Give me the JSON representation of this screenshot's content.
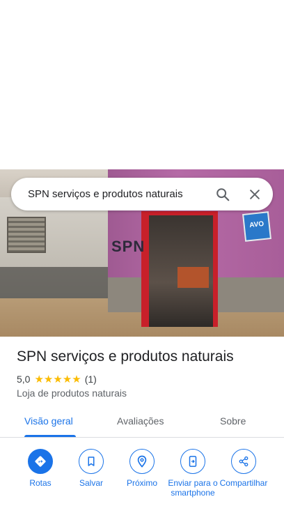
{
  "search": {
    "query": "SPN serviços e produtos naturais",
    "search_icon": "search-icon",
    "clear_icon": "close-icon"
  },
  "hero": {
    "sign_text": "SPN",
    "poster_text": "AVO"
  },
  "place": {
    "name": "SPN serviços e produtos naturais",
    "rating": "5,0",
    "stars": 5,
    "review_count": "(1)",
    "category": "Loja de produtos naturais"
  },
  "tabs": [
    {
      "label": "Visão geral",
      "active": true
    },
    {
      "label": "Avaliações",
      "active": false
    },
    {
      "label": "Sobre",
      "active": false
    }
  ],
  "actions": [
    {
      "label": "Rotas",
      "icon": "directions-icon"
    },
    {
      "label": "Salvar",
      "icon": "bookmark-icon"
    },
    {
      "label": "Próximo",
      "icon": "nearby-icon"
    },
    {
      "label": "Enviar para o smartphone",
      "icon": "send-to-phone-icon"
    },
    {
      "label": "Compartilhar",
      "icon": "share-icon"
    }
  ],
  "colors": {
    "accent": "#1a73e8",
    "star": "#fbbc04",
    "text_primary": "#202124",
    "text_secondary": "#5f6368"
  }
}
